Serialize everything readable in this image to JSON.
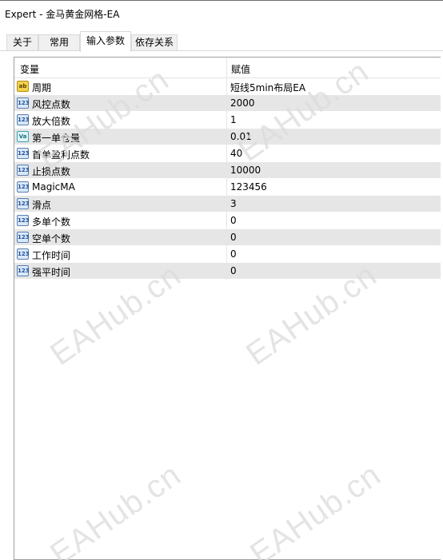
{
  "window": {
    "title": "Expert - 金马黄金网格-EA"
  },
  "tabs": [
    {
      "label": "关于"
    },
    {
      "label": "常用"
    },
    {
      "label": "输入参数"
    },
    {
      "label": "依存关系"
    }
  ],
  "grid": {
    "columns": {
      "variable": "变量",
      "value": "赋值"
    },
    "rows": [
      {
        "icon": "ab-string-icon",
        "icon_text": "ab",
        "name": "周期",
        "value": "短线5min布局EA"
      },
      {
        "icon": "integer-icon",
        "icon_text": "123",
        "name": "风控点数",
        "value": "2000"
      },
      {
        "icon": "integer-icon",
        "icon_text": "123",
        "name": "放大倍数",
        "value": "1"
      },
      {
        "icon": "double-icon",
        "icon_text": "Va",
        "name": "第一单仓量",
        "value": "0.01"
      },
      {
        "icon": "integer-icon",
        "icon_text": "123",
        "name": "首单盈利点数",
        "value": "40"
      },
      {
        "icon": "integer-icon",
        "icon_text": "123",
        "name": "止损点数",
        "value": "10000"
      },
      {
        "icon": "integer-icon",
        "icon_text": "123",
        "name": "MagicMA",
        "value": "123456"
      },
      {
        "icon": "integer-icon",
        "icon_text": "123",
        "name": "滑点",
        "value": "3"
      },
      {
        "icon": "integer-icon",
        "icon_text": "123",
        "name": "多单个数",
        "value": "0"
      },
      {
        "icon": "integer-icon",
        "icon_text": "123",
        "name": "空单个数",
        "value": "0"
      },
      {
        "icon": "integer-icon",
        "icon_text": "123",
        "name": "工作时间",
        "value": "0"
      },
      {
        "icon": "integer-icon",
        "icon_text": "123",
        "name": "强平时间",
        "value": "0"
      }
    ]
  },
  "watermark": {
    "text": "EAHub.cn"
  }
}
